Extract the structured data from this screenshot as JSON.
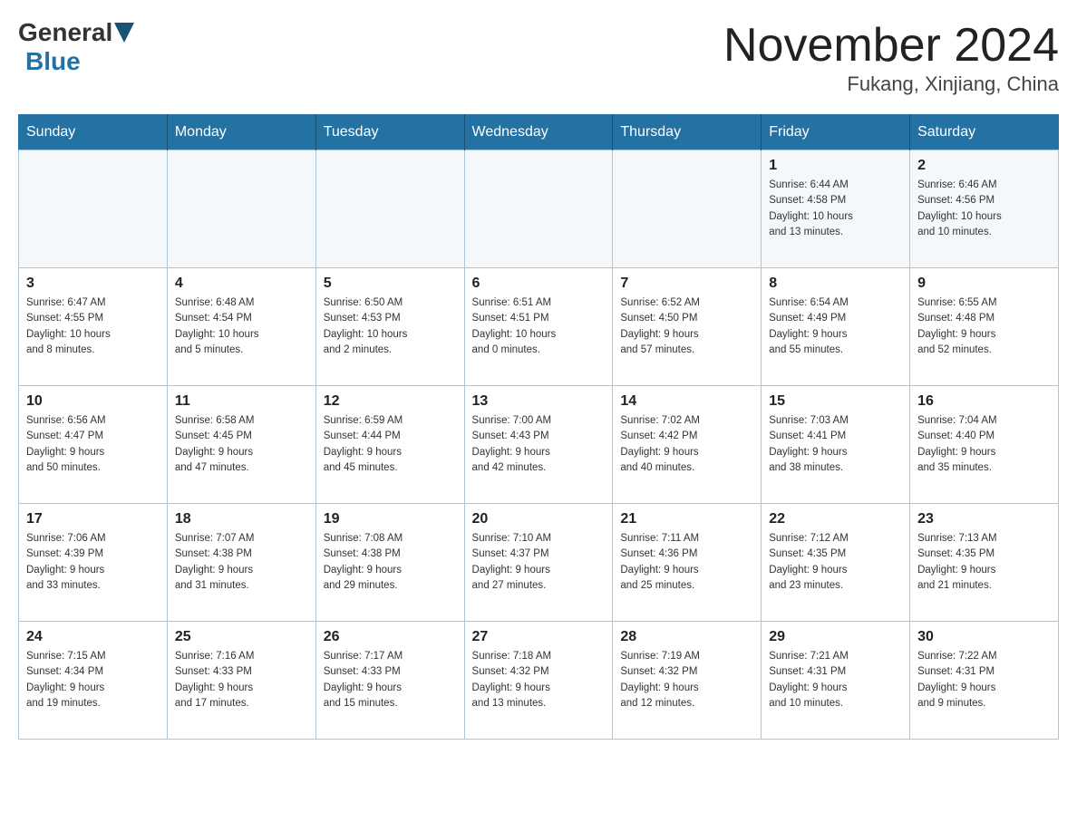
{
  "header": {
    "logo_general": "General",
    "logo_blue": "Blue",
    "month_title": "November 2024",
    "location": "Fukang, Xinjiang, China"
  },
  "weekdays": [
    "Sunday",
    "Monday",
    "Tuesday",
    "Wednesday",
    "Thursday",
    "Friday",
    "Saturday"
  ],
  "weeks": [
    [
      {
        "day": "",
        "info": ""
      },
      {
        "day": "",
        "info": ""
      },
      {
        "day": "",
        "info": ""
      },
      {
        "day": "",
        "info": ""
      },
      {
        "day": "",
        "info": ""
      },
      {
        "day": "1",
        "info": "Sunrise: 6:44 AM\nSunset: 4:58 PM\nDaylight: 10 hours\nand 13 minutes."
      },
      {
        "day": "2",
        "info": "Sunrise: 6:46 AM\nSunset: 4:56 PM\nDaylight: 10 hours\nand 10 minutes."
      }
    ],
    [
      {
        "day": "3",
        "info": "Sunrise: 6:47 AM\nSunset: 4:55 PM\nDaylight: 10 hours\nand 8 minutes."
      },
      {
        "day": "4",
        "info": "Sunrise: 6:48 AM\nSunset: 4:54 PM\nDaylight: 10 hours\nand 5 minutes."
      },
      {
        "day": "5",
        "info": "Sunrise: 6:50 AM\nSunset: 4:53 PM\nDaylight: 10 hours\nand 2 minutes."
      },
      {
        "day": "6",
        "info": "Sunrise: 6:51 AM\nSunset: 4:51 PM\nDaylight: 10 hours\nand 0 minutes."
      },
      {
        "day": "7",
        "info": "Sunrise: 6:52 AM\nSunset: 4:50 PM\nDaylight: 9 hours\nand 57 minutes."
      },
      {
        "day": "8",
        "info": "Sunrise: 6:54 AM\nSunset: 4:49 PM\nDaylight: 9 hours\nand 55 minutes."
      },
      {
        "day": "9",
        "info": "Sunrise: 6:55 AM\nSunset: 4:48 PM\nDaylight: 9 hours\nand 52 minutes."
      }
    ],
    [
      {
        "day": "10",
        "info": "Sunrise: 6:56 AM\nSunset: 4:47 PM\nDaylight: 9 hours\nand 50 minutes."
      },
      {
        "day": "11",
        "info": "Sunrise: 6:58 AM\nSunset: 4:45 PM\nDaylight: 9 hours\nand 47 minutes."
      },
      {
        "day": "12",
        "info": "Sunrise: 6:59 AM\nSunset: 4:44 PM\nDaylight: 9 hours\nand 45 minutes."
      },
      {
        "day": "13",
        "info": "Sunrise: 7:00 AM\nSunset: 4:43 PM\nDaylight: 9 hours\nand 42 minutes."
      },
      {
        "day": "14",
        "info": "Sunrise: 7:02 AM\nSunset: 4:42 PM\nDaylight: 9 hours\nand 40 minutes."
      },
      {
        "day": "15",
        "info": "Sunrise: 7:03 AM\nSunset: 4:41 PM\nDaylight: 9 hours\nand 38 minutes."
      },
      {
        "day": "16",
        "info": "Sunrise: 7:04 AM\nSunset: 4:40 PM\nDaylight: 9 hours\nand 35 minutes."
      }
    ],
    [
      {
        "day": "17",
        "info": "Sunrise: 7:06 AM\nSunset: 4:39 PM\nDaylight: 9 hours\nand 33 minutes."
      },
      {
        "day": "18",
        "info": "Sunrise: 7:07 AM\nSunset: 4:38 PM\nDaylight: 9 hours\nand 31 minutes."
      },
      {
        "day": "19",
        "info": "Sunrise: 7:08 AM\nSunset: 4:38 PM\nDaylight: 9 hours\nand 29 minutes."
      },
      {
        "day": "20",
        "info": "Sunrise: 7:10 AM\nSunset: 4:37 PM\nDaylight: 9 hours\nand 27 minutes."
      },
      {
        "day": "21",
        "info": "Sunrise: 7:11 AM\nSunset: 4:36 PM\nDaylight: 9 hours\nand 25 minutes."
      },
      {
        "day": "22",
        "info": "Sunrise: 7:12 AM\nSunset: 4:35 PM\nDaylight: 9 hours\nand 23 minutes."
      },
      {
        "day": "23",
        "info": "Sunrise: 7:13 AM\nSunset: 4:35 PM\nDaylight: 9 hours\nand 21 minutes."
      }
    ],
    [
      {
        "day": "24",
        "info": "Sunrise: 7:15 AM\nSunset: 4:34 PM\nDaylight: 9 hours\nand 19 minutes."
      },
      {
        "day": "25",
        "info": "Sunrise: 7:16 AM\nSunset: 4:33 PM\nDaylight: 9 hours\nand 17 minutes."
      },
      {
        "day": "26",
        "info": "Sunrise: 7:17 AM\nSunset: 4:33 PM\nDaylight: 9 hours\nand 15 minutes."
      },
      {
        "day": "27",
        "info": "Sunrise: 7:18 AM\nSunset: 4:32 PM\nDaylight: 9 hours\nand 13 minutes."
      },
      {
        "day": "28",
        "info": "Sunrise: 7:19 AM\nSunset: 4:32 PM\nDaylight: 9 hours\nand 12 minutes."
      },
      {
        "day": "29",
        "info": "Sunrise: 7:21 AM\nSunset: 4:31 PM\nDaylight: 9 hours\nand 10 minutes."
      },
      {
        "day": "30",
        "info": "Sunrise: 7:22 AM\nSunset: 4:31 PM\nDaylight: 9 hours\nand 9 minutes."
      }
    ]
  ]
}
